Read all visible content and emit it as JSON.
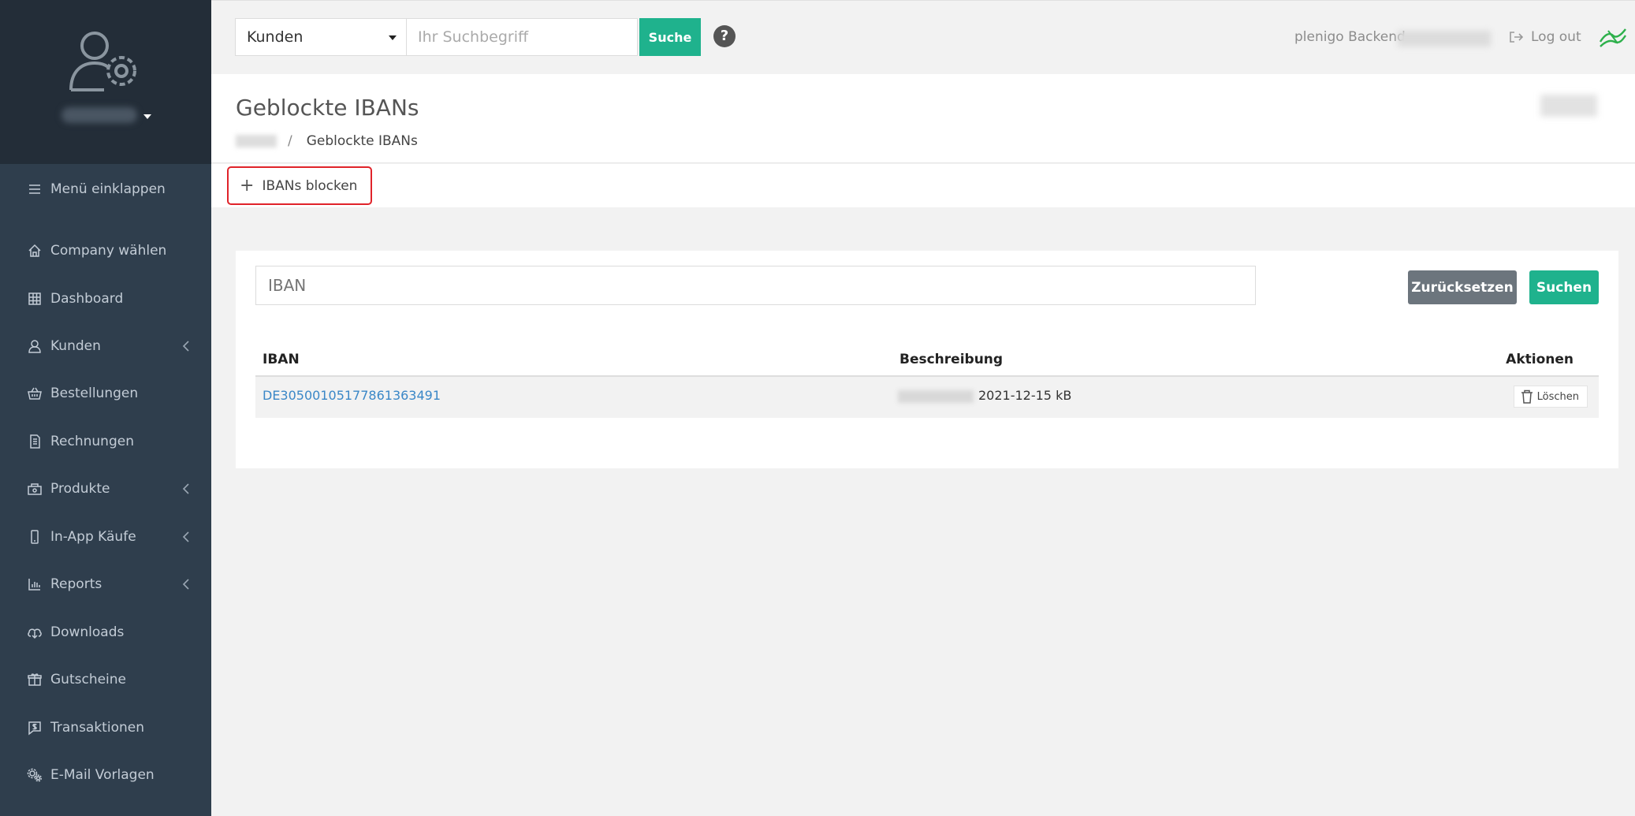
{
  "sidebar": {
    "collapse_label": "Menü einklappen",
    "items": [
      {
        "label": "Company wählen",
        "icon": "home-icon"
      },
      {
        "label": "Dashboard",
        "icon": "grid-icon"
      },
      {
        "label": "Kunden",
        "icon": "user-icon",
        "expandable": true
      },
      {
        "label": "Bestellungen",
        "icon": "basket-icon"
      },
      {
        "label": "Rechnungen",
        "icon": "invoice-icon"
      },
      {
        "label": "Produkte",
        "icon": "product-icon",
        "expandable": true
      },
      {
        "label": "In-App Käufe",
        "icon": "phone-icon",
        "expandable": true
      },
      {
        "label": "Reports",
        "icon": "chart-icon",
        "expandable": true
      },
      {
        "label": "Downloads",
        "icon": "cloud-download-icon"
      },
      {
        "label": "Gutscheine",
        "icon": "gift-icon"
      },
      {
        "label": "Transaktionen",
        "icon": "transaction-icon"
      },
      {
        "label": "E-Mail Vorlagen",
        "icon": "gears-icon"
      }
    ]
  },
  "topbar": {
    "search_category": "Kunden",
    "search_placeholder": "Ihr Suchbegriff",
    "search_button": "Suche",
    "help_symbol": "?",
    "backend_label": "plenigo Backend",
    "logout_label": "Log out"
  },
  "page": {
    "title": "Geblockte IBANs",
    "breadcrumb_current": "Geblockte IBANs",
    "breadcrumb_separator": "/",
    "block_button": "IBANs blocken",
    "block_button_symbol": "+"
  },
  "filter": {
    "placeholder": "IBAN",
    "reset_button": "Zurücksetzen",
    "search_button": "Suchen"
  },
  "table": {
    "columns": [
      "IBAN",
      "Beschreibung",
      "Aktionen"
    ],
    "rows": [
      {
        "iban": "DE30500105177861363491",
        "description": "2021-12-15 kB",
        "action": "Löschen"
      }
    ]
  },
  "colors": {
    "accent": "#1fb28d",
    "sidebar_bg": "#2f3e4d",
    "sidebar_top_bg": "#232d38",
    "link": "#3a87c7",
    "highlight_border": "#e0232a",
    "secondary_button": "#6c757d"
  }
}
